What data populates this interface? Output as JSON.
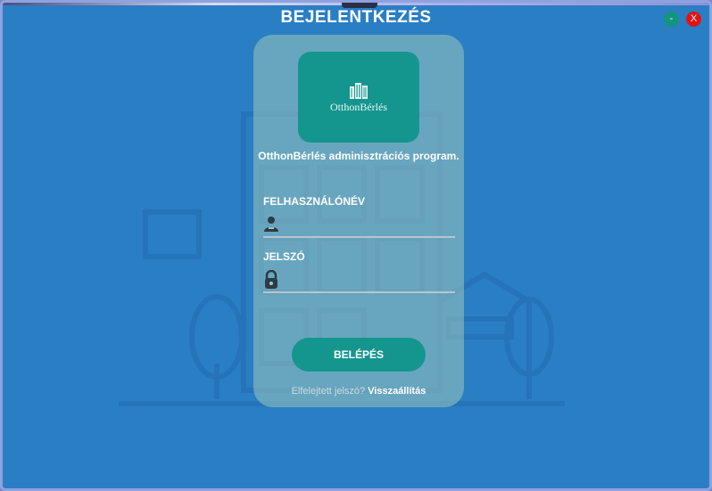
{
  "window": {
    "title": "BEJELENTKEZÉS",
    "minimize_label": "-",
    "close_label": "X"
  },
  "logo": {
    "text": "OtthonBérlés"
  },
  "subtitle": "OtthonBérlés adminisztrációs program.",
  "username": {
    "label": "FELHASZNÁLÓNÉV",
    "value": "",
    "placeholder": ""
  },
  "password": {
    "label": "JELSZÓ",
    "value": "",
    "placeholder": ""
  },
  "login_button": "BELÉPÉS",
  "forgot": {
    "question": "Elfelejtett jelszó?",
    "link": "Visszaállítás"
  },
  "colors": {
    "background": "#2a7ec4",
    "accent": "#14968f",
    "close": "#e01414"
  }
}
